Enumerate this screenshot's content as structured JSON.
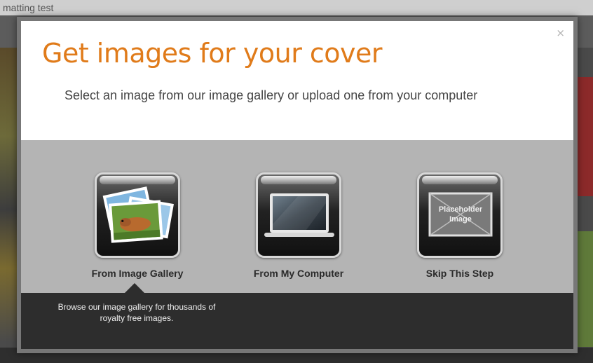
{
  "background": {
    "page_title": "matting test"
  },
  "modal": {
    "title": "Get images for your cover",
    "subtitle": "Select an image from our image gallery or upload one from your computer",
    "close_label": "×",
    "options": [
      {
        "label": "From Image Gallery",
        "icon": "photo-stack-icon"
      },
      {
        "label": "From My Computer",
        "icon": "laptop-icon"
      },
      {
        "label": "Skip This Step",
        "icon": "placeholder-image-icon",
        "placeholder_text": "Placeholder Image"
      }
    ],
    "description": "Browse our image gallery for thousands of royalty free images."
  },
  "colors": {
    "title": "#e07b1a",
    "options_band": "#b4b4b4",
    "footer": "#2d2d2d"
  }
}
